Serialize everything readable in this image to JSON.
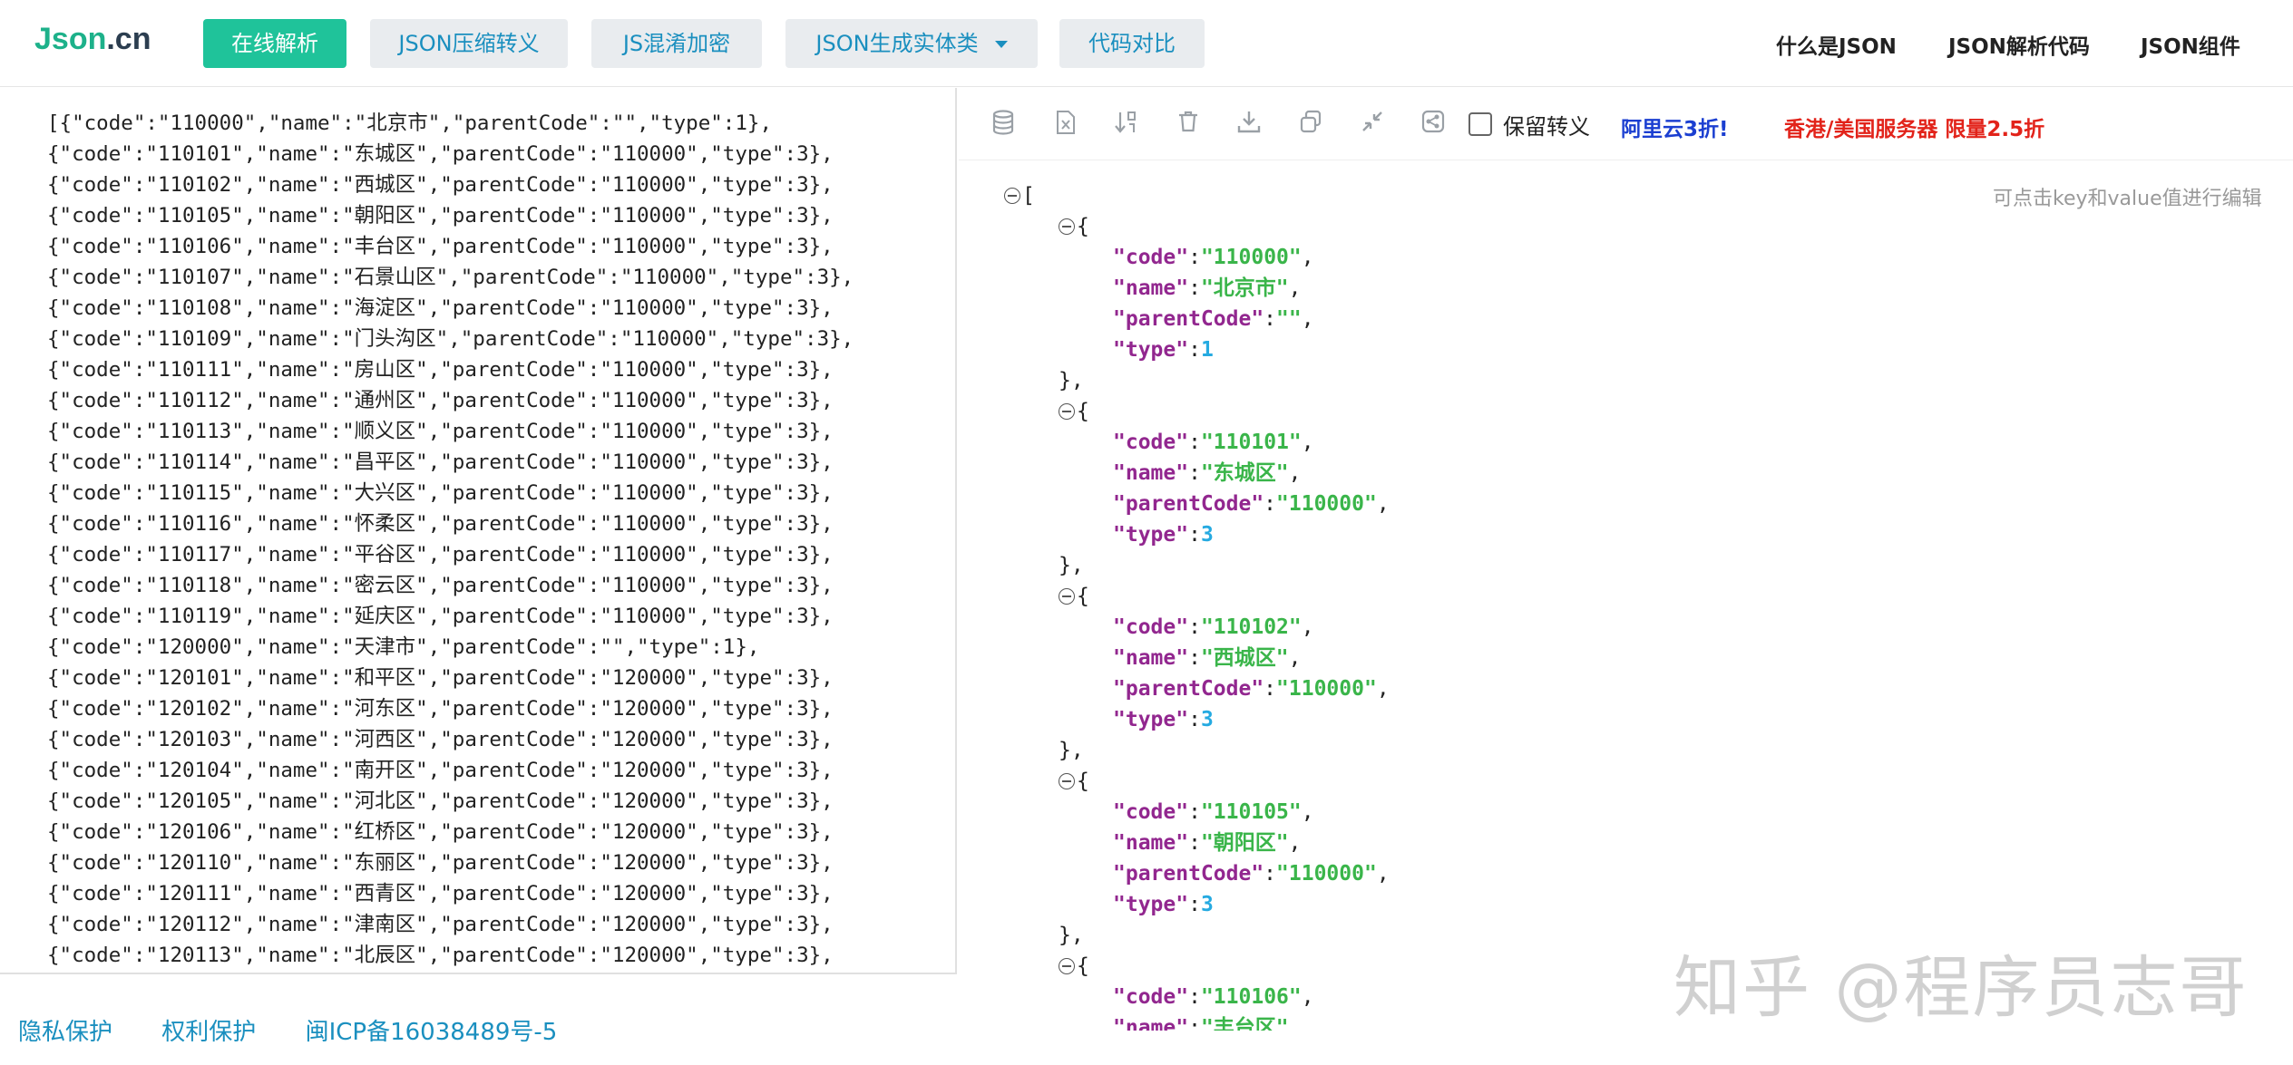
{
  "brand": {
    "logo_main": "Json",
    "logo_suffix": ".cn"
  },
  "nav": {
    "buttons": [
      {
        "label": "在线解析",
        "active": true
      },
      {
        "label": "JSON压缩转义",
        "active": false
      },
      {
        "label": "JS混淆加密",
        "active": false
      },
      {
        "label": "JSON生成实体类",
        "active": false,
        "dropdown": true
      },
      {
        "label": "代码对比",
        "active": false
      }
    ],
    "right_links": [
      "什么是JSON",
      "JSON解析代码",
      "JSON组件"
    ]
  },
  "left_editor": {
    "lines": [
      "[{\"code\":\"110000\",\"name\":\"北京市\",\"parentCode\":\"\",\"type\":1},",
      "{\"code\":\"110101\",\"name\":\"东城区\",\"parentCode\":\"110000\",\"type\":3},",
      "{\"code\":\"110102\",\"name\":\"西城区\",\"parentCode\":\"110000\",\"type\":3},",
      "{\"code\":\"110105\",\"name\":\"朝阳区\",\"parentCode\":\"110000\",\"type\":3},",
      "{\"code\":\"110106\",\"name\":\"丰台区\",\"parentCode\":\"110000\",\"type\":3},",
      "{\"code\":\"110107\",\"name\":\"石景山区\",\"parentCode\":\"110000\",\"type\":3},",
      "{\"code\":\"110108\",\"name\":\"海淀区\",\"parentCode\":\"110000\",\"type\":3},",
      "{\"code\":\"110109\",\"name\":\"门头沟区\",\"parentCode\":\"110000\",\"type\":3},",
      "{\"code\":\"110111\",\"name\":\"房山区\",\"parentCode\":\"110000\",\"type\":3},",
      "{\"code\":\"110112\",\"name\":\"通州区\",\"parentCode\":\"110000\",\"type\":3},",
      "{\"code\":\"110113\",\"name\":\"顺义区\",\"parentCode\":\"110000\",\"type\":3},",
      "{\"code\":\"110114\",\"name\":\"昌平区\",\"parentCode\":\"110000\",\"type\":3},",
      "{\"code\":\"110115\",\"name\":\"大兴区\",\"parentCode\":\"110000\",\"type\":3},",
      "{\"code\":\"110116\",\"name\":\"怀柔区\",\"parentCode\":\"110000\",\"type\":3},",
      "{\"code\":\"110117\",\"name\":\"平谷区\",\"parentCode\":\"110000\",\"type\":3},",
      "{\"code\":\"110118\",\"name\":\"密云区\",\"parentCode\":\"110000\",\"type\":3},",
      "{\"code\":\"110119\",\"name\":\"延庆区\",\"parentCode\":\"110000\",\"type\":3},",
      "{\"code\":\"120000\",\"name\":\"天津市\",\"parentCode\":\"\",\"type\":1},",
      "{\"code\":\"120101\",\"name\":\"和平区\",\"parentCode\":\"120000\",\"type\":3},",
      "{\"code\":\"120102\",\"name\":\"河东区\",\"parentCode\":\"120000\",\"type\":3},",
      "{\"code\":\"120103\",\"name\":\"河西区\",\"parentCode\":\"120000\",\"type\":3},",
      "{\"code\":\"120104\",\"name\":\"南开区\",\"parentCode\":\"120000\",\"type\":3},",
      "{\"code\":\"120105\",\"name\":\"河北区\",\"parentCode\":\"120000\",\"type\":3},",
      "{\"code\":\"120106\",\"name\":\"红桥区\",\"parentCode\":\"120000\",\"type\":3},",
      "{\"code\":\"120110\",\"name\":\"东丽区\",\"parentCode\":\"120000\",\"type\":3},",
      "{\"code\":\"120111\",\"name\":\"西青区\",\"parentCode\":\"120000\",\"type\":3},",
      "{\"code\":\"120112\",\"name\":\"津南区\",\"parentCode\":\"120000\",\"type\":3},",
      "{\"code\":\"120113\",\"name\":\"北辰区\",\"parentCode\":\"120000\",\"type\":3},"
    ]
  },
  "toolbar": {
    "icons": [
      "database-icon",
      "excel-icon",
      "sort-icon",
      "trash-icon",
      "download-icon",
      "copy-icon",
      "compress-icon",
      "share-icon"
    ],
    "keep_escape_label": "保留转义",
    "aliyun_label": "阿里云3折!",
    "promo_label": "香港/美国服务器 限量2.5折"
  },
  "viewer": {
    "edit_hint": "可点击key和value值进行编辑",
    "records": [
      {
        "code": "110000",
        "name": "北京市",
        "parentCode": "",
        "type": "1"
      },
      {
        "code": "110101",
        "name": "东城区",
        "parentCode": "110000",
        "type": "3"
      },
      {
        "code": "110102",
        "name": "西城区",
        "parentCode": "110000",
        "type": "3"
      },
      {
        "code": "110105",
        "name": "朝阳区",
        "parentCode": "110000",
        "type": "3"
      },
      {
        "code": "110106",
        "name": "丰台区"
      }
    ]
  },
  "watermark": "知乎 @程序员志哥",
  "footer": {
    "links": [
      "隐私保护",
      "权利保护",
      "闽ICP备16038489号-5"
    ]
  },
  "colors": {
    "brand_green": "#1fc39a",
    "link_blue": "#1a8fbf",
    "json_key": "#92278f",
    "json_string": "#3ab54a",
    "json_number": "#25aae1",
    "promo_red": "#e2231a",
    "aliyun_blue": "#1b3fd1"
  }
}
